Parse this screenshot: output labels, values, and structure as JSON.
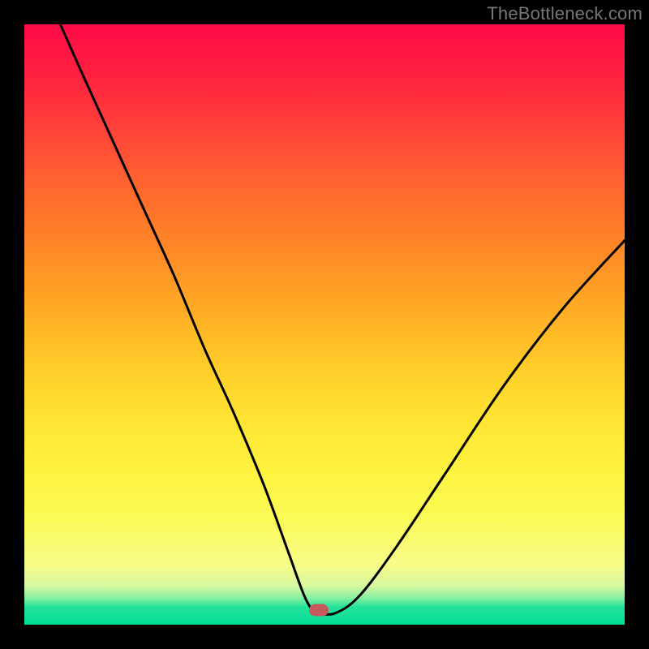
{
  "watermark": "TheBottleneck.com",
  "marker": {
    "x_frac": 0.49,
    "y_frac": 0.975
  },
  "chart_data": {
    "type": "line",
    "title": "",
    "xlabel": "",
    "ylabel": "",
    "xlim": [
      0,
      1
    ],
    "ylim": [
      0,
      1
    ],
    "series": [
      {
        "name": "bottleneck-curve",
        "x": [
          0.06,
          0.1,
          0.15,
          0.2,
          0.25,
          0.3,
          0.35,
          0.4,
          0.44,
          0.47,
          0.49,
          0.52,
          0.56,
          0.62,
          0.7,
          0.8,
          0.9,
          1.0
        ],
        "y": [
          1.0,
          0.91,
          0.8,
          0.69,
          0.58,
          0.46,
          0.35,
          0.23,
          0.12,
          0.04,
          0.02,
          0.02,
          0.05,
          0.13,
          0.25,
          0.4,
          0.53,
          0.64
        ]
      }
    ],
    "markers": [
      {
        "name": "optimal-point",
        "x": 0.49,
        "y": 0.025
      }
    ],
    "background_gradient": {
      "top": "#ff0a46",
      "mid": "#ffe433",
      "bottom": "#00dd94"
    }
  }
}
